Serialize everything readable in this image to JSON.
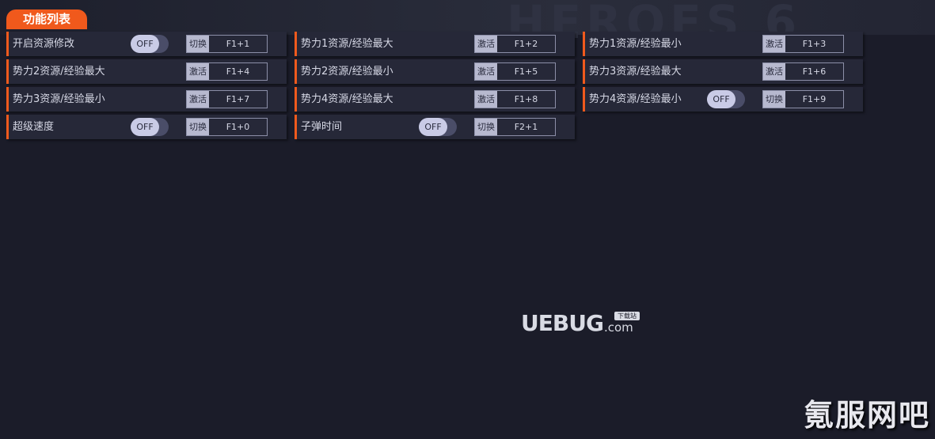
{
  "header": {
    "title": "功能列表",
    "background_text": "HEROES 6"
  },
  "colors": {
    "accent": "#f05a1d",
    "row_bg": "#262838",
    "page_bg": "#1b1c29"
  },
  "features": [
    {
      "label": "开启资源修改",
      "toggle": "OFF",
      "action": "切换",
      "key": "F1+1"
    },
    {
      "label": "势力1资源/经验最大",
      "toggle": null,
      "action": "激活",
      "key": "F1+2"
    },
    {
      "label": "势力1资源/经验最小",
      "toggle": null,
      "action": "激活",
      "key": "F1+3"
    },
    {
      "label": "势力2资源/经验最大",
      "toggle": null,
      "action": "激活",
      "key": "F1+4"
    },
    {
      "label": "势力2资源/经验最小",
      "toggle": null,
      "action": "激活",
      "key": "F1+5"
    },
    {
      "label": "势力3资源/经验最大",
      "toggle": null,
      "action": "激活",
      "key": "F1+6"
    },
    {
      "label": "势力3资源/经验最小",
      "toggle": null,
      "action": "激活",
      "key": "F1+7"
    },
    {
      "label": "势力4资源/经验最大",
      "toggle": null,
      "action": "激活",
      "key": "F1+8"
    },
    {
      "label": "势力4资源/经验最小",
      "toggle": "OFF",
      "action": "切换",
      "key": "F1+9"
    },
    {
      "label": "超级速度",
      "toggle": "OFF",
      "action": "切换",
      "key": "F1+0"
    },
    {
      "label": "子弹时间",
      "toggle": "OFF",
      "action": "切换",
      "key": "F2+1"
    }
  ],
  "watermark": {
    "main": "UEBUG",
    "suffix": ".com",
    "badge": "下载站"
  },
  "corner_watermark": "氪服网吧"
}
